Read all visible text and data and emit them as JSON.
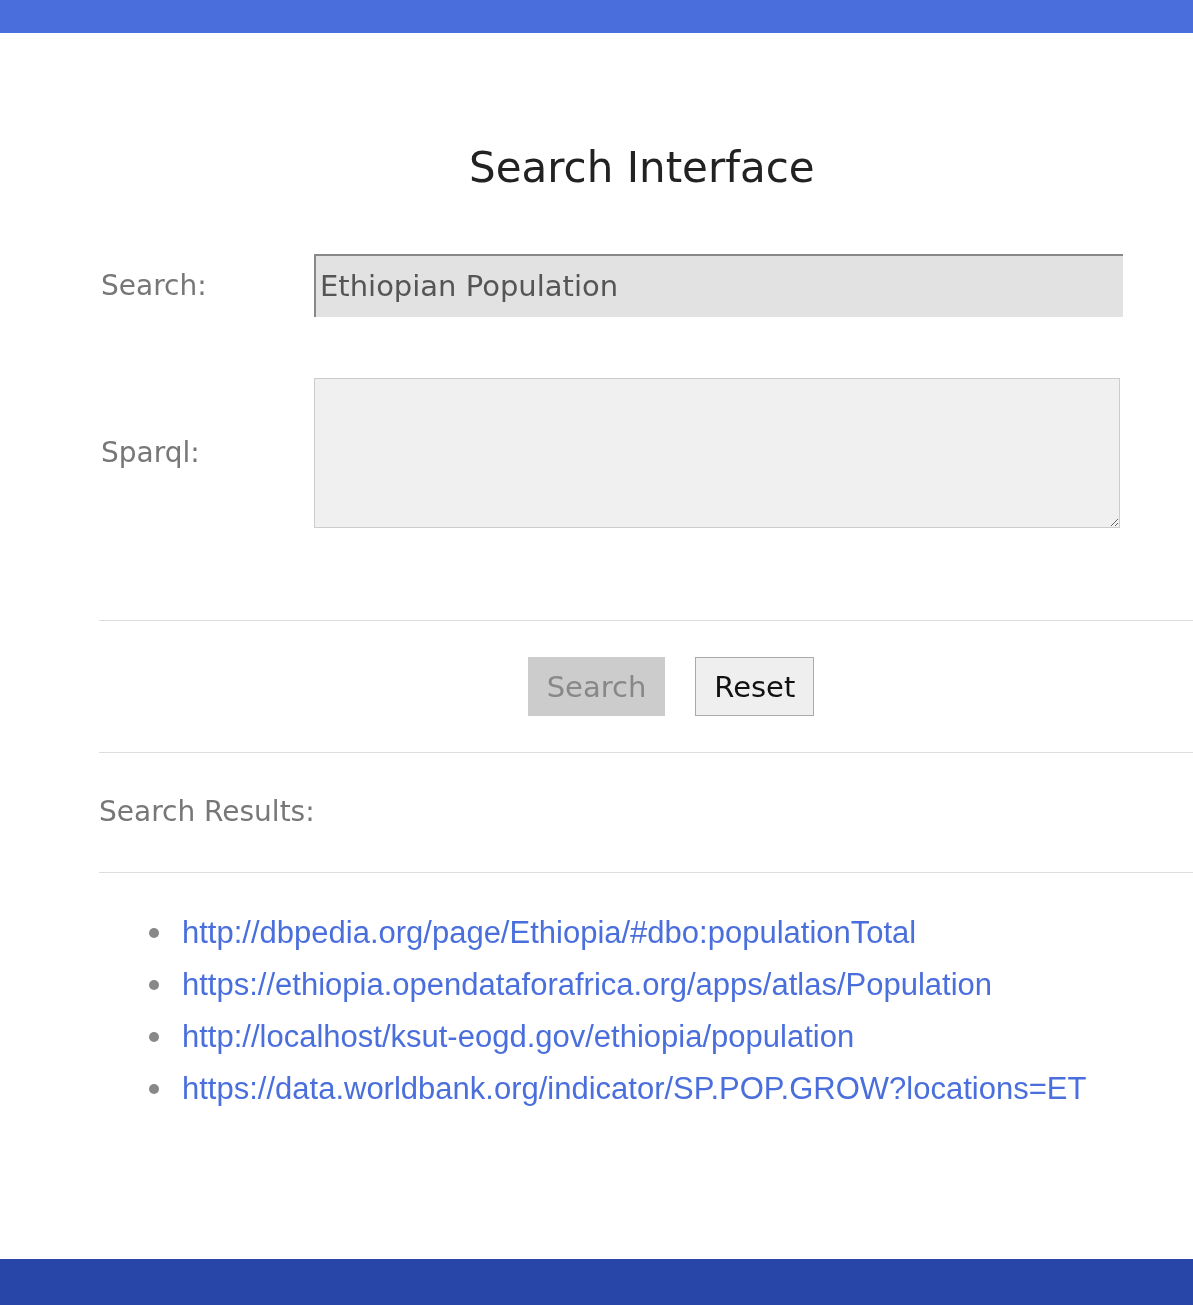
{
  "title": "Search Interface",
  "search": {
    "label": "Search:",
    "value": "Ethiopian Population"
  },
  "sparql": {
    "label": "Sparql:"
  },
  "buttons": [
    {
      "label": "Search",
      "disabled": true
    },
    {
      "label": "Reset",
      "disabled": false
    }
  ],
  "results": {
    "heading": "Search Results:",
    "links": [
      "http://dbpedia.org/page/Ethiopia/#dbo:populationTotal",
      "https://ethiopia.opendataforafrica.org/apps/atlas/Population",
      "http://localhost/ksut-eogd.gov/ethiopia/population",
      "https://data.worldbank.org/indicator/SP.POP.GROW?locations=ET"
    ]
  }
}
